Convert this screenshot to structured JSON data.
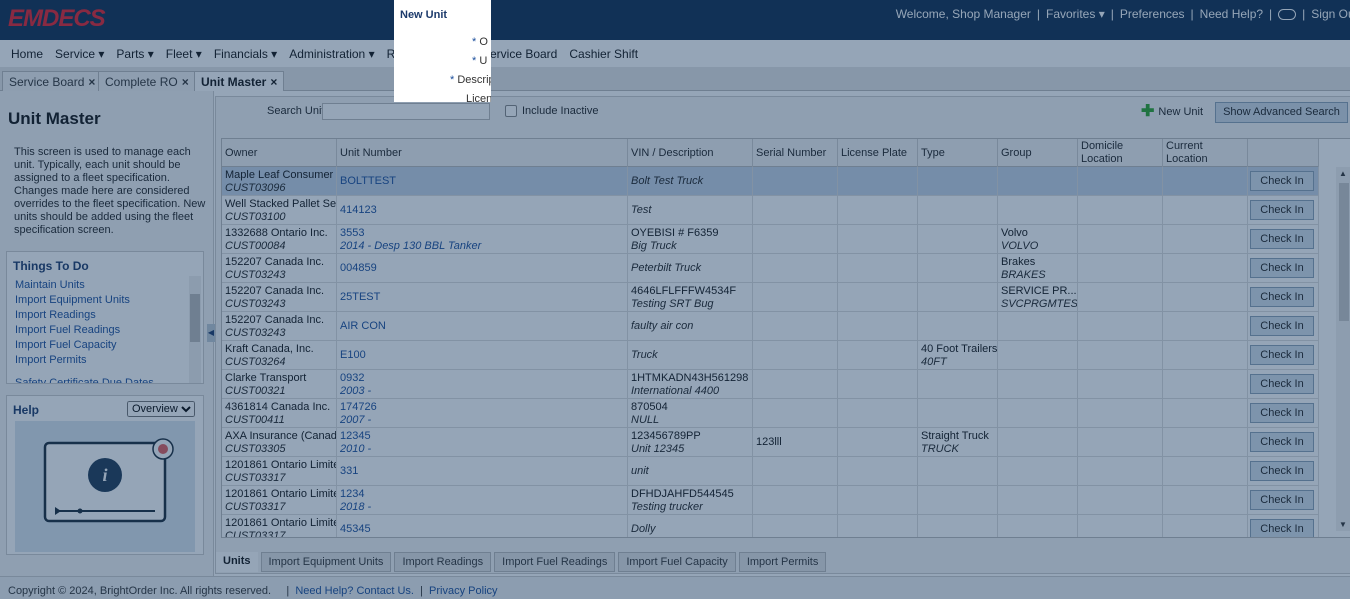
{
  "app": {
    "logo": "EMDECS",
    "brand_color": "#e8202a"
  },
  "topbar": {
    "welcome": "Welcome, Shop Manager",
    "favorites": "Favorites",
    "preferences": "Preferences",
    "need_help": "Need Help?",
    "sign_out": "Sign Out"
  },
  "menu": [
    "Home",
    "Service",
    "Parts",
    "Fleet",
    "Financials",
    "Administration",
    "Reports",
    "Search Service Board",
    "Cashier Shift"
  ],
  "tabs": [
    "Service Board",
    "Complete RO",
    "Unit Master"
  ],
  "left": {
    "title": "Unit Master",
    "description": "This screen is used to manage each unit. Typically, each unit should be assigned to a fleet specification. Changes made here are considered overrides to the fleet specification. New units should be added using the fleet specification screen.",
    "todo_title": "Things To Do",
    "todo_items": [
      "Maintain Units",
      "Import Equipment Units",
      "Import Readings",
      "Import Fuel Readings",
      "Import Fuel Capacity",
      "Import Permits",
      "Safety Certificate Due Dates"
    ],
    "help_title": "Help",
    "help_select": "Overview"
  },
  "toolbar": {
    "search_label": "Search Unit",
    "include_inactive": "Include Inactive",
    "new_unit": "New Unit",
    "advanced_search": "Show Advanced Search"
  },
  "grid": {
    "columns": [
      "Owner",
      "Unit Number",
      "VIN / Description",
      "Serial Number",
      "License Plate",
      "Type",
      "Group",
      "Domicile Location",
      "Current Location"
    ],
    "check_in_label": "Check In",
    "rows": [
      {
        "owner": "Maple Leaf Consumer",
        "cust": "CUST03096",
        "unit": "BOLTTEST",
        "unit2": "",
        "vin": "",
        "desc": "Bolt Test Truck",
        "serial": "",
        "type": "",
        "type2": "",
        "group": "",
        "group2": ""
      },
      {
        "owner": "Well Stacked Pallet Ser",
        "cust": "CUST03100",
        "unit": "414123",
        "unit2": "",
        "vin": "",
        "desc": "Test",
        "serial": "",
        "type": "",
        "type2": "",
        "group": "",
        "group2": ""
      },
      {
        "owner": "1332688 Ontario Inc.",
        "cust": "CUST00084",
        "unit": "3553",
        "unit2": "2014 - Desp 130 BBL Tanker",
        "vin": "OYEBISI # F6359",
        "desc": "Big Truck",
        "serial": "",
        "type": "",
        "type2": "",
        "group": "Volvo",
        "group2": "VOLVO"
      },
      {
        "owner": "152207 Canada Inc.",
        "cust": "CUST03243",
        "unit": "004859",
        "unit2": "",
        "vin": "",
        "desc": "Peterbilt Truck",
        "serial": "",
        "type": "",
        "type2": "",
        "group": "Brakes",
        "group2": "BRAKES"
      },
      {
        "owner": "152207 Canada Inc.",
        "cust": "CUST03243",
        "unit": "25TEST",
        "unit2": "",
        "vin": "4646LFLFFFW4534F",
        "desc": "Testing SRT Bug",
        "serial": "",
        "type": "",
        "type2": "",
        "group": "SERVICE PR...",
        "group2": "SVCPRGMTEST"
      },
      {
        "owner": "152207 Canada Inc.",
        "cust": "CUST03243",
        "unit": "AIR CON",
        "unit2": "",
        "vin": "",
        "desc": "faulty air con",
        "serial": "",
        "type": "",
        "type2": "",
        "group": "",
        "group2": ""
      },
      {
        "owner": "Kraft Canada, Inc.",
        "cust": "CUST03264",
        "unit": "E100",
        "unit2": "",
        "vin": "",
        "desc": "Truck",
        "serial": "",
        "type": "40 Foot Trailers",
        "type2": "40FT",
        "group": "",
        "group2": ""
      },
      {
        "owner": "Clarke Transport",
        "cust": "CUST00321",
        "unit": "0932",
        "unit2": "2003 -",
        "vin": "1HTMKADN43H561298",
        "desc": "International 4400",
        "serial": "",
        "type": "",
        "type2": "",
        "group": "",
        "group2": ""
      },
      {
        "owner": "4361814 Canada Inc.",
        "cust": "CUST00411",
        "unit": "174726",
        "unit2": "2007 -",
        "vin": "870504",
        "desc": "NULL",
        "serial": "",
        "type": "",
        "type2": "",
        "group": "",
        "group2": ""
      },
      {
        "owner": "AXA Insurance (Canada",
        "cust": "CUST03305",
        "unit": "12345",
        "unit2": "2010 -",
        "vin": "123456789PP",
        "desc": "Unit 12345",
        "serial": "123lll",
        "type": "Straight Truck",
        "type2": "TRUCK",
        "group": "",
        "group2": ""
      },
      {
        "owner": "1201861 Ontario Limite",
        "cust": "CUST03317",
        "unit": "331",
        "unit2": "",
        "vin": "",
        "desc": "unit",
        "serial": "",
        "type": "",
        "type2": "",
        "group": "",
        "group2": ""
      },
      {
        "owner": "1201861 Ontario Limite",
        "cust": "CUST03317",
        "unit": "1234",
        "unit2": "2018 -",
        "vin": "DFHDJAHFD544545",
        "desc": "Testing trucker",
        "serial": "",
        "type": "",
        "type2": "",
        "group": "",
        "group2": ""
      },
      {
        "owner": "1201861 Ontario Limite",
        "cust": "CUST03317",
        "unit": "45345",
        "unit2": "",
        "vin": "",
        "desc": "Dolly",
        "serial": "",
        "type": "",
        "type2": "",
        "group": "",
        "group2": ""
      }
    ]
  },
  "bottom_tabs": [
    "Units",
    "Import Equipment Units",
    "Import Readings",
    "Import Fuel Readings",
    "Import Fuel Capacity",
    "Import Permits"
  ],
  "footer": {
    "copyright": "Copyright © 2024, BrightOrder Inc. All rights reserved.",
    "help_link": "Need Help? Contact Us.",
    "privacy": "Privacy Policy"
  },
  "modal": {
    "title": "New Unit",
    "fields": [
      "O",
      "U",
      "Descrip",
      "Licen"
    ]
  }
}
